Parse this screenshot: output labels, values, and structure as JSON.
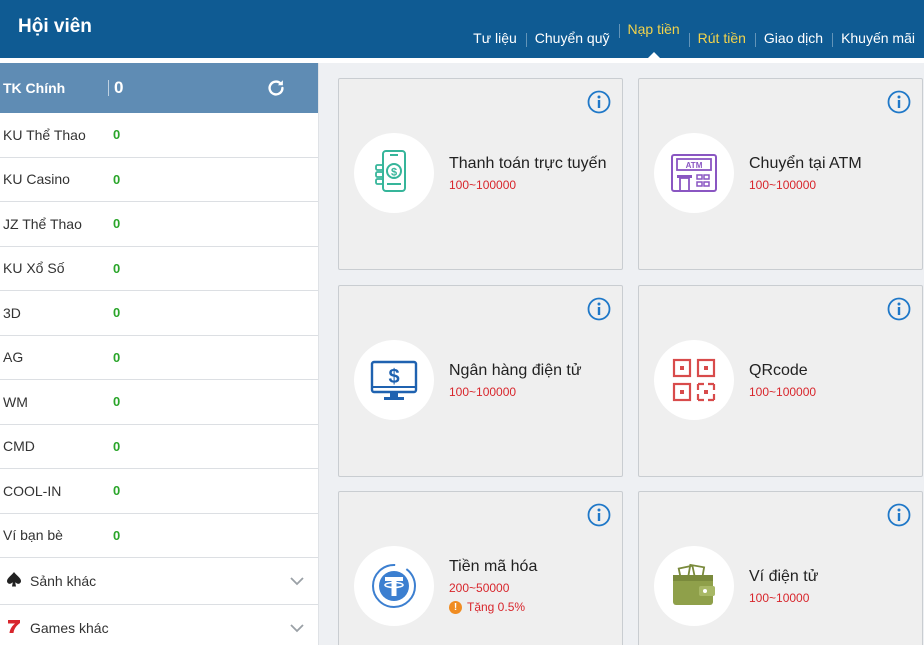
{
  "header": {
    "title": "Hội viên"
  },
  "nav": {
    "items": [
      {
        "label": "Tư liệu"
      },
      {
        "label": "Chuyển quỹ"
      },
      {
        "label": "Nạp tiền"
      },
      {
        "label": "Rút tiền"
      },
      {
        "label": "Giao dịch"
      },
      {
        "label": "Khuyến mãi"
      }
    ],
    "active": "Nạp tiền"
  },
  "sidebar": {
    "main_account": {
      "label": "TK Chính",
      "value": "0"
    },
    "wallets": [
      {
        "name": "KU Thể Thao",
        "amount": "0"
      },
      {
        "name": "KU Casino",
        "amount": "0"
      },
      {
        "name": "JZ Thể Thao",
        "amount": "0"
      },
      {
        "name": "KU Xổ Số",
        "amount": "0"
      },
      {
        "name": "3D",
        "amount": "0"
      },
      {
        "name": "AG",
        "amount": "0"
      },
      {
        "name": "WM",
        "amount": "0"
      },
      {
        "name": "CMD",
        "amount": "0"
      },
      {
        "name": "COOL-IN",
        "amount": "0"
      },
      {
        "name": "Ví bạn bè",
        "amount": "0"
      }
    ],
    "groups": [
      {
        "label": "Sảnh khác",
        "icon": "spade-icon"
      },
      {
        "label": "Games khác",
        "icon": "seven-icon"
      }
    ]
  },
  "methods": [
    {
      "title": "Thanh toán trực tuyến",
      "range": "100~100000",
      "icon": "mobile-payment-icon"
    },
    {
      "title": "Chuyển tại ATM",
      "range": "100~100000",
      "icon": "atm-icon"
    },
    {
      "title": "Ngân hàng điện tử",
      "range": "100~100000",
      "icon": "monitor-dollar-icon"
    },
    {
      "title": "QRcode",
      "range": "100~100000",
      "icon": "qrcode-icon"
    },
    {
      "title": "Tiền mã hóa",
      "range": "200~50000",
      "bonus": "Tặng 0.5%",
      "icon": "tether-icon"
    },
    {
      "title": "Ví điện tử",
      "range": "100~10000",
      "icon": "wallet-icon"
    }
  ],
  "colors": {
    "header_bg": "#0f5b93",
    "active_nav": "#f2d34b",
    "account_bar": "#5f8cb4",
    "amount_green": "#2aa52a",
    "range_red": "#d8262c",
    "info_blue": "#1f78c8"
  }
}
